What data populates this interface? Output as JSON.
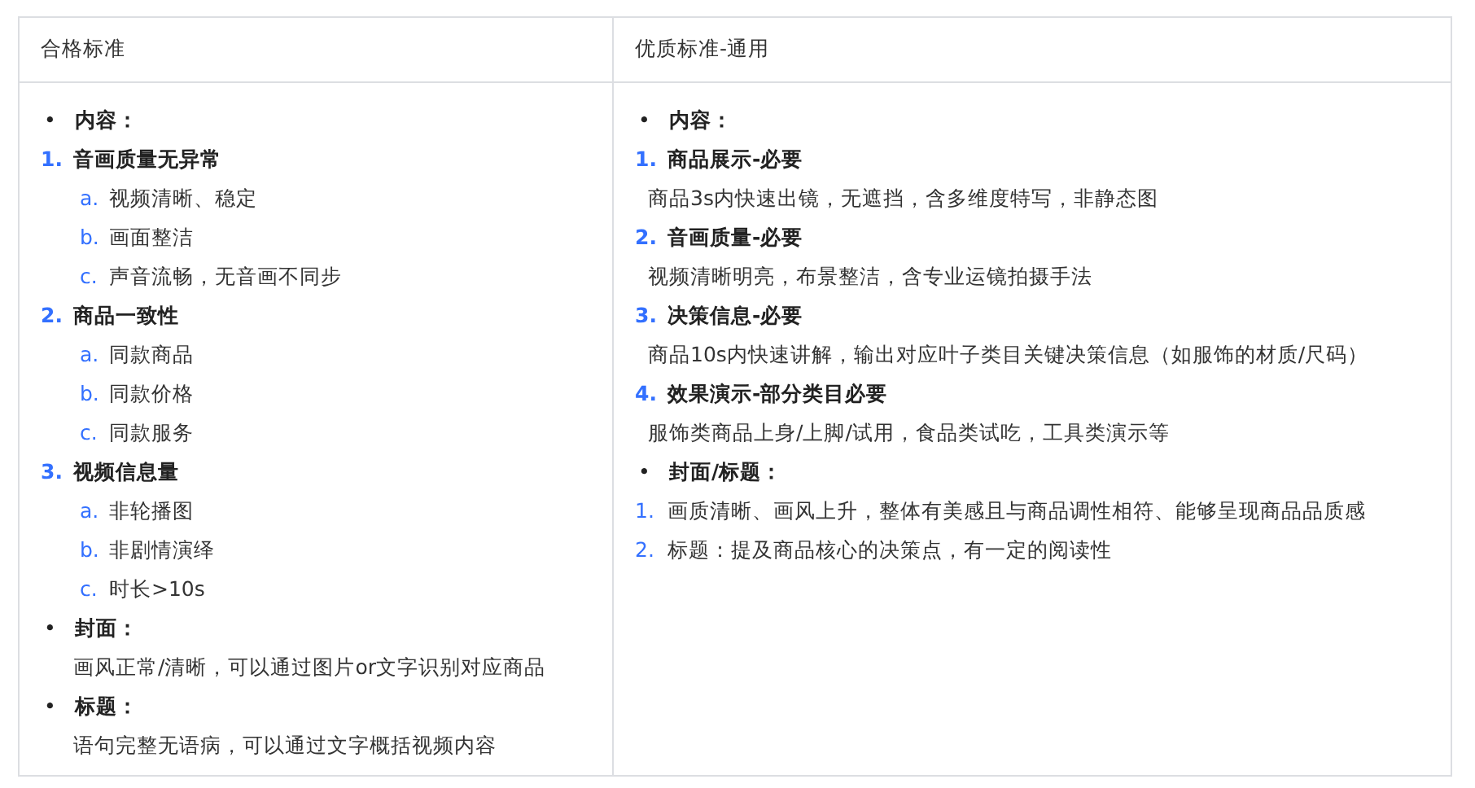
{
  "table": {
    "columns": [
      "合格标准",
      "优质标准-通用"
    ],
    "cells": [
      [
        {
          "kind": "bullet-heading",
          "marker": "•",
          "text": "内容："
        },
        {
          "kind": "number-heading",
          "marker": "1.",
          "text": "音画质量无异常"
        },
        {
          "kind": "letter",
          "marker": "a.",
          "text": "视频清晰、稳定"
        },
        {
          "kind": "letter",
          "marker": "b.",
          "text": "画面整洁"
        },
        {
          "kind": "letter",
          "marker": "c.",
          "text": "声音流畅，无音画不同步"
        },
        {
          "kind": "number-heading",
          "marker": "2.",
          "text": "商品一致性"
        },
        {
          "kind": "letter",
          "marker": "a.",
          "text": "同款商品"
        },
        {
          "kind": "letter",
          "marker": "b.",
          "text": "同款价格"
        },
        {
          "kind": "letter",
          "marker": "c.",
          "text": "同款服务"
        },
        {
          "kind": "number-heading",
          "marker": "3.",
          "text": "视频信息量"
        },
        {
          "kind": "letter",
          "marker": "a.",
          "text": "非轮播图"
        },
        {
          "kind": "letter",
          "marker": "b.",
          "text": "非剧情演绎"
        },
        {
          "kind": "letter",
          "marker": "c.",
          "text": "时长>10s"
        },
        {
          "kind": "bullet-heading",
          "marker": "•",
          "text": "封面："
        },
        {
          "kind": "note",
          "text": "画风正常/清晰，可以通过图片or文字识别对应商品"
        },
        {
          "kind": "bullet-heading",
          "marker": "•",
          "text": "标题："
        },
        {
          "kind": "note",
          "text": "语句完整无语病，可以通过文字概括视频内容"
        }
      ],
      [
        {
          "kind": "bullet-heading",
          "marker": "•",
          "text": "内容："
        },
        {
          "kind": "number-heading",
          "marker": "1.",
          "text": "商品展示-必要"
        },
        {
          "kind": "note",
          "text": "商品3s内快速出镜，无遮挡，含多维度特写，非静态图"
        },
        {
          "kind": "number-heading",
          "marker": "2.",
          "text": "音画质量-必要"
        },
        {
          "kind": "note",
          "text": "视频清晰明亮，布景整洁，含专业运镜拍摄手法"
        },
        {
          "kind": "number-heading",
          "marker": "3.",
          "text": "决策信息-必要"
        },
        {
          "kind": "note",
          "text": "商品10s内快速讲解，输出对应叶子类目关键决策信息（如服饰的材质/尺码）"
        },
        {
          "kind": "number-heading",
          "marker": "4.",
          "text": "效果演示-部分类目必要"
        },
        {
          "kind": "note",
          "text": "服饰类商品上身/上脚/试用，食品类试吃，工具类演示等"
        },
        {
          "kind": "bullet-heading",
          "marker": "•",
          "text": "封面/标题："
        },
        {
          "kind": "number",
          "marker": "1.",
          "text": "画质清晰、画风上升，整体有美感且与商品调性相符、能够呈现商品品质感"
        },
        {
          "kind": "number",
          "marker": "2.",
          "text": "标题：提及商品核心的决策点，有一定的阅读性"
        }
      ]
    ]
  }
}
